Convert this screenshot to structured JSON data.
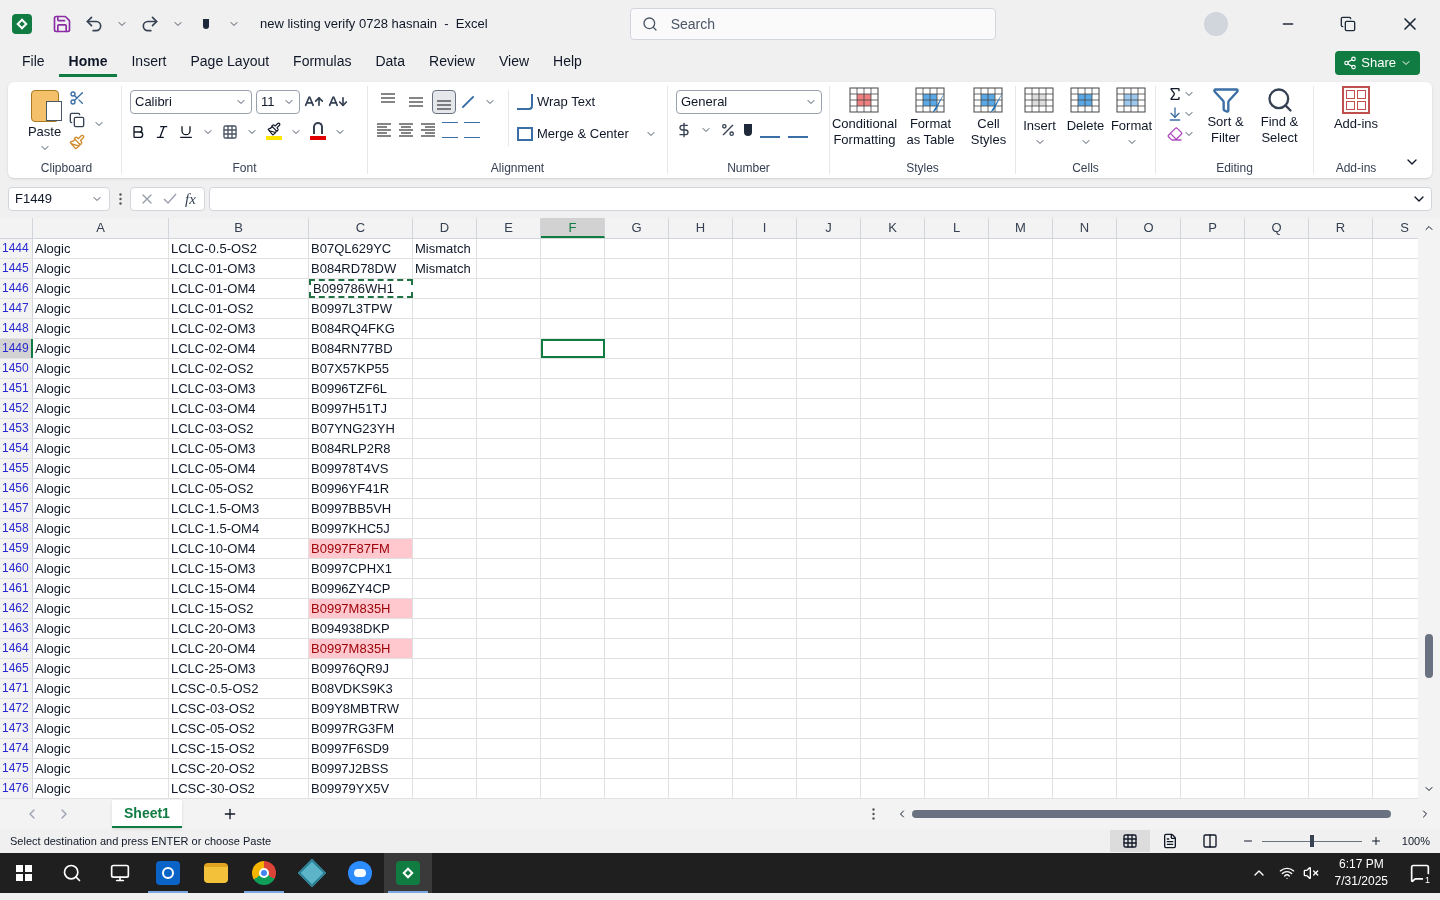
{
  "title_bar": {
    "title": "new listing verify 0728 hasnain  -  Excel",
    "search_placeholder": "Search"
  },
  "menu_tabs": [
    {
      "label": "File",
      "selected": false
    },
    {
      "label": "Home",
      "selected": true
    },
    {
      "label": "Insert",
      "selected": false
    },
    {
      "label": "Page Layout",
      "selected": false
    },
    {
      "label": "Formulas",
      "selected": false
    },
    {
      "label": "Data",
      "selected": false
    },
    {
      "label": "Review",
      "selected": false
    },
    {
      "label": "View",
      "selected": false
    },
    {
      "label": "Help",
      "selected": false
    }
  ],
  "share_button": "Share",
  "ribbon": {
    "clipboard": {
      "paste": "Paste",
      "label": "Clipboard"
    },
    "font": {
      "font_name": "Calibri",
      "font_size": "11",
      "label": "Font"
    },
    "alignment": {
      "vertical_align_buttons": [
        {
          "selected": false
        },
        {
          "selected": false
        },
        {
          "selected": true
        }
      ],
      "wrap_text": "Wrap Text",
      "merge_center": "Merge & Center",
      "label": "Alignment"
    },
    "number": {
      "format": "General",
      "label": "Number"
    },
    "styles": {
      "buttons": [
        "Conditional Formatting",
        "Format as Table",
        "Cell Styles"
      ],
      "label": "Styles"
    },
    "cells": {
      "buttons": [
        "Insert",
        "Delete",
        "Format"
      ],
      "label": "Cells"
    },
    "editing": {
      "buttons": [
        "Sort & Filter",
        "Find & Select"
      ],
      "label": "Editing"
    },
    "addins": {
      "button": "Add-ins",
      "label": "Add-ins"
    }
  },
  "formula_bar": {
    "name_box": "F1449",
    "function_label": "fx"
  },
  "columns": [
    {
      "label": "A",
      "selected": false
    },
    {
      "label": "B",
      "selected": false
    },
    {
      "label": "C",
      "selected": false
    },
    {
      "label": "D",
      "selected": false
    },
    {
      "label": "E",
      "selected": false
    },
    {
      "label": "F",
      "selected": true
    },
    {
      "label": "G",
      "selected": false
    },
    {
      "label": "H",
      "selected": false
    },
    {
      "label": "I",
      "selected": false
    },
    {
      "label": "J",
      "selected": false
    },
    {
      "label": "K",
      "selected": false
    },
    {
      "label": "L",
      "selected": false
    },
    {
      "label": "M",
      "selected": false
    },
    {
      "label": "N",
      "selected": false
    },
    {
      "label": "O",
      "selected": false
    },
    {
      "label": "P",
      "selected": false
    },
    {
      "label": "Q",
      "selected": false
    },
    {
      "label": "R",
      "selected": false
    },
    {
      "label": "S",
      "selected": false
    }
  ],
  "rows": [
    {
      "number": "1444",
      "selected": false,
      "a": "Alogic",
      "b": "LCLC-0.5-OS2",
      "c": "B07QL629YC",
      "d": "Mismatch",
      "flagged": false,
      "copied": false
    },
    {
      "number": "1445",
      "selected": false,
      "a": "Alogic",
      "b": "LCLC-01-OM3",
      "c": "B084RD78DW",
      "d": "Mismatch",
      "flagged": false,
      "copied": false
    },
    {
      "number": "1446",
      "selected": false,
      "a": "Alogic",
      "b": "LCLC-01-OM4",
      "c": "B099786WH1",
      "flagged": false,
      "copied": true
    },
    {
      "number": "1447",
      "selected": false,
      "a": "Alogic",
      "b": "LCLC-01-OS2",
      "c": "B0997L3TPW",
      "flagged": false,
      "copied": false
    },
    {
      "number": "1448",
      "selected": false,
      "a": "Alogic",
      "b": "LCLC-02-OM3",
      "c": "B084RQ4FKG",
      "flagged": false,
      "copied": false
    },
    {
      "number": "1449",
      "selected": true,
      "a": "Alogic",
      "b": "LCLC-02-OM4",
      "c": "B084RN77BD",
      "flagged": false,
      "copied": false
    },
    {
      "number": "1450",
      "selected": false,
      "a": "Alogic",
      "b": "LCLC-02-OS2",
      "c": "B07X57KP55",
      "flagged": false,
      "copied": false
    },
    {
      "number": "1451",
      "selected": false,
      "a": "Alogic",
      "b": "LCLC-03-OM3",
      "c": "B0996TZF6L",
      "flagged": false,
      "copied": false
    },
    {
      "number": "1452",
      "selected": false,
      "a": "Alogic",
      "b": "LCLC-03-OM4",
      "c": "B0997H51TJ",
      "flagged": false,
      "copied": false
    },
    {
      "number": "1453",
      "selected": false,
      "a": "Alogic",
      "b": "LCLC-03-OS2",
      "c": "B07YNG23YH",
      "flagged": false,
      "copied": false
    },
    {
      "number": "1454",
      "selected": false,
      "a": "Alogic",
      "b": "LCLC-05-OM3",
      "c": "B084RLP2R8",
      "flagged": false,
      "copied": false
    },
    {
      "number": "1455",
      "selected": false,
      "a": "Alogic",
      "b": "LCLC-05-OM4",
      "c": "B09978T4VS",
      "flagged": false,
      "copied": false
    },
    {
      "number": "1456",
      "selected": false,
      "a": "Alogic",
      "b": "LCLC-05-OS2",
      "c": "B0996YF41R",
      "flagged": false,
      "copied": false
    },
    {
      "number": "1457",
      "selected": false,
      "a": "Alogic",
      "b": "LCLC-1.5-OM3",
      "c": "B0997BB5VH",
      "flagged": false,
      "copied": false
    },
    {
      "number": "1458",
      "selected": false,
      "a": "Alogic",
      "b": "LCLC-1.5-OM4",
      "c": "B0997KHC5J",
      "flagged": false,
      "copied": false
    },
    {
      "number": "1459",
      "selected": false,
      "a": "Alogic",
      "b": "LCLC-10-OM4",
      "c": "B0997F87FM",
      "flagged": true,
      "copied": false
    },
    {
      "number": "1460",
      "selected": false,
      "a": "Alogic",
      "b": "LCLC-15-OM3",
      "c": "B0997CPHX1",
      "flagged": false,
      "copied": false
    },
    {
      "number": "1461",
      "selected": false,
      "a": "Alogic",
      "b": "LCLC-15-OM4",
      "c": "B0996ZY4CP",
      "flagged": false,
      "copied": false
    },
    {
      "number": "1462",
      "selected": false,
      "a": "Alogic",
      "b": "LCLC-15-OS2",
      "c": "B0997M835H",
      "flagged": true,
      "copied": false
    },
    {
      "number": "1463",
      "selected": false,
      "a": "Alogic",
      "b": "LCLC-20-OM3",
      "c": "B094938DKP",
      "flagged": false,
      "copied": false
    },
    {
      "number": "1464",
      "selected": false,
      "a": "Alogic",
      "b": "LCLC-20-OM4",
      "c": "B0997M835H",
      "flagged": true,
      "copied": false
    },
    {
      "number": "1465",
      "selected": false,
      "a": "Alogic",
      "b": "LCLC-25-OM3",
      "c": "B09976QR9J",
      "flagged": false,
      "copied": false
    },
    {
      "number": "1471",
      "selected": false,
      "a": "Alogic",
      "b": "LCSC-0.5-OS2",
      "c": "B08VDKS9K3",
      "flagged": false,
      "copied": false
    },
    {
      "number": "1472",
      "selected": false,
      "a": "Alogic",
      "b": "LCSC-03-OS2",
      "c": "B09Y8MBTRW",
      "flagged": false,
      "copied": false
    },
    {
      "number": "1473",
      "selected": false,
      "a": "Alogic",
      "b": "LCSC-05-OS2",
      "c": "B0997RG3FM",
      "flagged": false,
      "copied": false
    },
    {
      "number": "1474",
      "selected": false,
      "a": "Alogic",
      "b": "LCSC-15-OS2",
      "c": "B0997F6SD9",
      "flagged": false,
      "copied": false
    },
    {
      "number": "1475",
      "selected": false,
      "a": "Alogic",
      "b": "LCSC-20-OS2",
      "c": "B0997J2BSS",
      "flagged": false,
      "copied": false
    },
    {
      "number": "1476",
      "selected": false,
      "a": "Alogic",
      "b": "LCSC-30-OS2",
      "c": "B09979YX5V",
      "flagged": false,
      "copied": false
    }
  ],
  "sheet_tabs": [
    {
      "label": "Sheet1",
      "selected": true
    }
  ],
  "status_bar": {
    "message": "Select destination and press ENTER or choose Paste",
    "zoom": "100%",
    "zoom_level": {
      "level": 0.5
    }
  },
  "taskbar": {
    "apps": [
      {
        "kind": "outlook",
        "running": true,
        "selected": false
      },
      {
        "kind": "folder",
        "running": false,
        "selected": false
      },
      {
        "kind": "chrome",
        "running": true,
        "selected": false
      },
      {
        "kind": "diamond",
        "running": false,
        "selected": false
      },
      {
        "kind": "zoom",
        "running": false,
        "selected": false
      },
      {
        "kind": "excel",
        "running": true,
        "selected": true
      }
    ],
    "time": "6:17 PM",
    "date": "7/31/2025",
    "notifications": "1"
  }
}
